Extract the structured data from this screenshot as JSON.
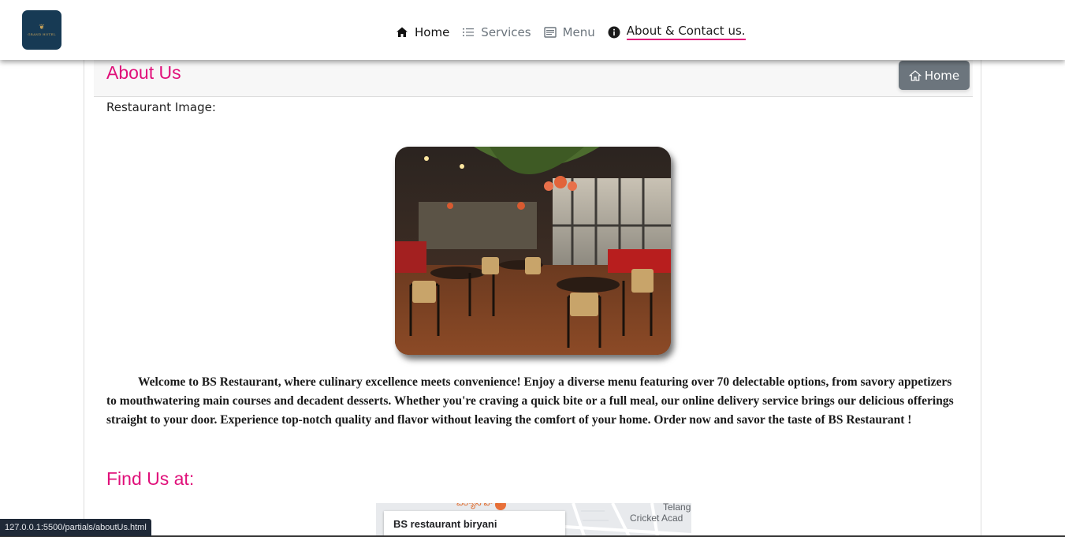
{
  "navbar": {
    "logo_text": "GRAND HOTEL",
    "items": [
      {
        "label": "Home",
        "icon": "house-fill-icon"
      },
      {
        "label": "Services",
        "icon": "list-icon"
      },
      {
        "label": "Menu",
        "icon": "menu-card-icon"
      },
      {
        "label": "About & Contact us.",
        "icon": "info-circle-icon"
      }
    ],
    "active_index": 3,
    "accent_color": "#e0107a"
  },
  "about": {
    "title": "About Us",
    "home_button_label": "Home",
    "image_label": "Restaurant Image:",
    "description": "Welcome to BS Restaurant, where culinary excellence meets convenience! Enjoy a diverse menu featuring over 70 delectable options, from savory appetizers to mouthwatering main courses and decadent desserts. Whether you're craving a quick bite or a full meal, our online delivery service brings our delicious offerings straight to your door. Experience top-notch quality and flavor without leaving the comfort of your home. Order now and savor the taste of BS Restaurant !"
  },
  "find_us": {
    "title": "Find Us at:",
    "map": {
      "place_name": "BS restaurant biryani",
      "labels": [
        "Telang",
        "Cricket Acad",
        "బిర్యానీ హౌస్"
      ]
    }
  },
  "status_bar": {
    "url": "127.0.0.1:5500/partials/aboutUs.html"
  }
}
